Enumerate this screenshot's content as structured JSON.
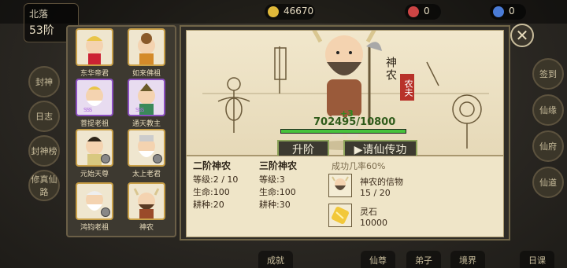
{
  "background": {
    "player_region": "北落",
    "player_level": "53阶",
    "resources": [
      "46670",
      "0",
      "0"
    ],
    "side_buttons_left": [
      "封神",
      "日志",
      "封神榜",
      "修真仙路"
    ],
    "side_buttons_right": [
      "签到",
      "仙缘",
      "仙府",
      "仙道"
    ],
    "bottom_buttons": [
      "成就",
      "仙尊",
      "弟子",
      "境界",
      "日课"
    ]
  },
  "character_list": [
    {
      "name": "东华帝君",
      "frame": "gold",
      "stars": "",
      "locked": false
    },
    {
      "name": "如来佛祖",
      "frame": "gold",
      "stars": "",
      "locked": false
    },
    {
      "name": "菩提老祖",
      "frame": "purple",
      "stars": "SSS",
      "locked": false
    },
    {
      "name": "通天教主",
      "frame": "purple",
      "stars": "SSS",
      "locked": false
    },
    {
      "name": "元始天尊",
      "frame": "gold",
      "stars": "",
      "locked": true
    },
    {
      "name": "太上老君",
      "frame": "gold",
      "stars": "",
      "locked": true
    },
    {
      "name": "鸿钧老祖",
      "frame": "gold",
      "stars": "",
      "locked": true
    },
    {
      "name": "神农",
      "frame": "gold",
      "stars": "",
      "locked": false
    }
  ],
  "detail": {
    "name": "神农",
    "title": "农夫",
    "progress_text": "702495/10800",
    "progress_fraction": 1.0,
    "plus": "+3",
    "upgrade_button": "升阶",
    "summon_button": "▶请仙传功",
    "current_stage": {
      "title": "二阶神农",
      "level": "等级:2 / 10",
      "hp": "生命:100",
      "farming": "耕种:20"
    },
    "next_stage": {
      "title": "三阶神农",
      "level": "等级:3",
      "hp": "生命:100",
      "farming": "耕种:30"
    },
    "success_rate": "成功几率60%",
    "items": [
      {
        "name": "神农的信物",
        "amount": "15 / 20",
        "icon": "shennong-token-icon"
      },
      {
        "name": "灵石",
        "amount": "10000",
        "icon": "spirit-stone-icon"
      }
    ]
  },
  "colors": {
    "panel_bg": "#efe5c8",
    "frame_gold": "#8c7b58",
    "frame_purple": "#8b4fc0",
    "progress_green": "#47c23b",
    "button_border": "#8da45a",
    "title_red": "#b8322a"
  }
}
